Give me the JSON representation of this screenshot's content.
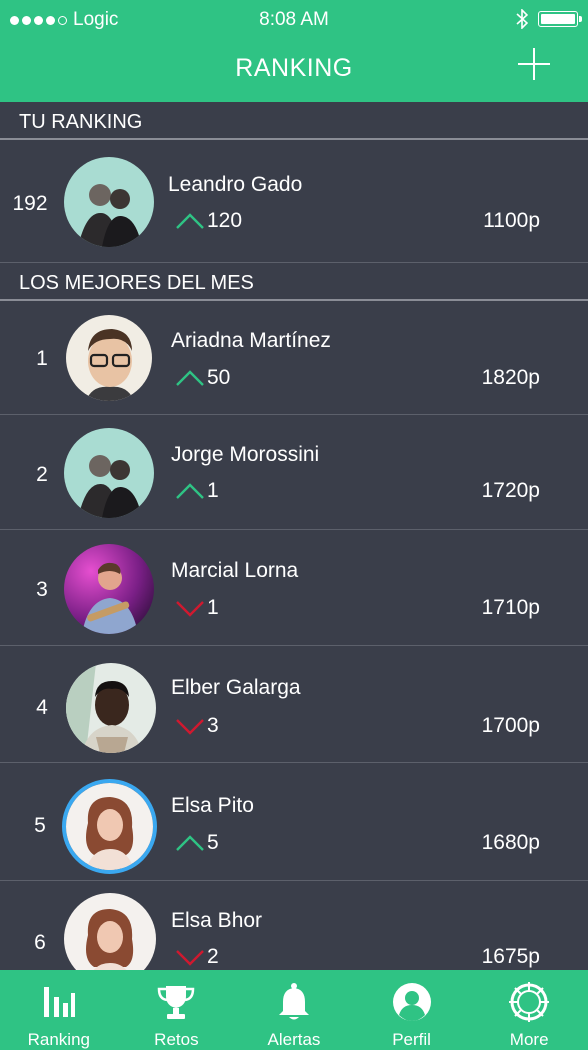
{
  "status_bar": {
    "carrier": "Logic",
    "time": "8:08 AM"
  },
  "nav": {
    "title": "RANKING"
  },
  "my_ranking": {
    "header": "TU RANKING",
    "rank": "192",
    "name": "Leandro Gado",
    "trend": "up",
    "delta": "120",
    "points": "1100p"
  },
  "best_of_month": {
    "header": "LOS MEJORES DEL MES",
    "entries": [
      {
        "rank": "1",
        "name": "Ariadna Martínez",
        "trend": "up",
        "delta": "50",
        "points": "1820p"
      },
      {
        "rank": "2",
        "name": "Jorge Morossini",
        "trend": "up",
        "delta": "1",
        "points": "1720p"
      },
      {
        "rank": "3",
        "name": "Marcial Lorna",
        "trend": "down",
        "delta": "1",
        "points": "1710p"
      },
      {
        "rank": "4",
        "name": "Elber Galarga",
        "trend": "down",
        "delta": "3",
        "points": "1700p"
      },
      {
        "rank": "5",
        "name": "Elsa Pito",
        "trend": "up",
        "delta": "5",
        "points": "1680p"
      },
      {
        "rank": "6",
        "name": "Elsa Bhor",
        "trend": "down",
        "delta": "2",
        "points": "1675p"
      }
    ]
  },
  "tabs": [
    {
      "label": "Ranking",
      "icon": "bar-chart-icon"
    },
    {
      "label": "Retos",
      "icon": "trophy-icon"
    },
    {
      "label": "Alertas",
      "icon": "bell-icon"
    },
    {
      "label": "Perfil",
      "icon": "user-icon"
    },
    {
      "label": "More",
      "icon": "more-icon"
    }
  ],
  "colors": {
    "accent": "#2fc384",
    "background": "#3a3e4a",
    "up": "#2fc384",
    "down": "#d0192f",
    "highlight_ring": "#3aa8f0"
  }
}
